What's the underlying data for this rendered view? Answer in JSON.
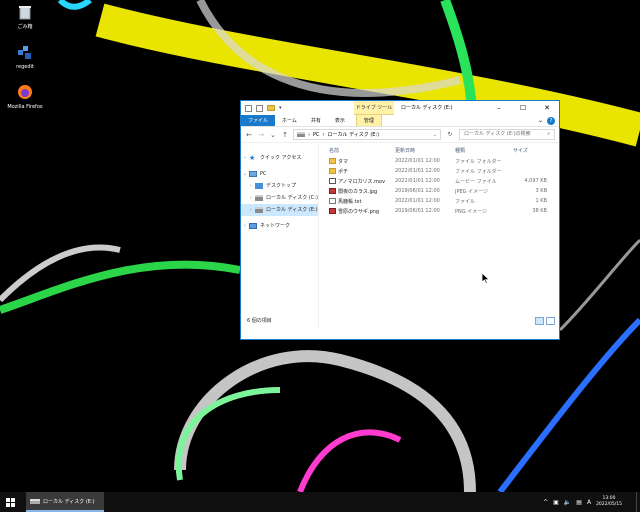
{
  "desktop": {
    "icons": [
      {
        "label": "ごみ箱",
        "icon": "recycle-bin-icon"
      },
      {
        "label": "regedit",
        "icon": "regedit-icon"
      },
      {
        "label": "Mozilla Firefox",
        "icon": "firefox-icon"
      }
    ]
  },
  "window": {
    "title": "ローカル ディスク (E:)",
    "context_tab": "ドライブ ツール",
    "controls": {
      "minimize": "–",
      "maximize": "☐",
      "close": "✕"
    },
    "ribbon_tabs": [
      "ファイル",
      "ホーム",
      "共有",
      "表示",
      "管理"
    ],
    "address": {
      "crumbs": [
        "PC",
        "ローカル ディスク (E:)"
      ]
    },
    "search_placeholder": "ローカル ディスク (E:)の検索",
    "nav": {
      "quick_access": "クイック アクセス",
      "pc": "PC",
      "desktop": "デスクトップ",
      "local_c": "ローカル ディスク (C:)",
      "local_e": "ローカル ディスク (E:)",
      "network": "ネットワーク"
    },
    "columns": {
      "name": "名前",
      "date": "更新日時",
      "type": "種類",
      "size": "サイズ"
    },
    "files": [
      {
        "name": "タマ",
        "date": "2022/01/01 12:00",
        "type": "ファイル フォルダー",
        "size": "",
        "kind": "folder"
      },
      {
        "name": "ポチ",
        "date": "2022/01/01 12:00",
        "type": "ファイル フォルダー",
        "size": "",
        "kind": "folder"
      },
      {
        "name": "アノマロカリス.mov",
        "date": "2022/01/01 12:00",
        "type": "ムービー ファイル",
        "size": "4,097 KB",
        "kind": "movie"
      },
      {
        "name": "闇夜のカラス.jpg",
        "date": "2019/06/01 12:00",
        "type": "JPEG イメージ",
        "size": "3 KB",
        "kind": "jpg"
      },
      {
        "name": "馬鹿帳.txt",
        "date": "2022/01/01 12:00",
        "type": "ファイル",
        "size": "1 KB",
        "kind": "txt"
      },
      {
        "name": "雪原のウサギ.png",
        "date": "2019/06/01 12:00",
        "type": "PNG イメージ",
        "size": "38 KB",
        "kind": "png"
      }
    ],
    "status": "6 個の項目"
  },
  "taskbar": {
    "app_label": "ローカル ディスク (E:)",
    "ime": "A",
    "time": "13:00",
    "date": "2022/05/15"
  },
  "colors": {
    "accent": "#1979ca",
    "context_tab": "#fff2a8",
    "selected": "#cce8ff"
  }
}
